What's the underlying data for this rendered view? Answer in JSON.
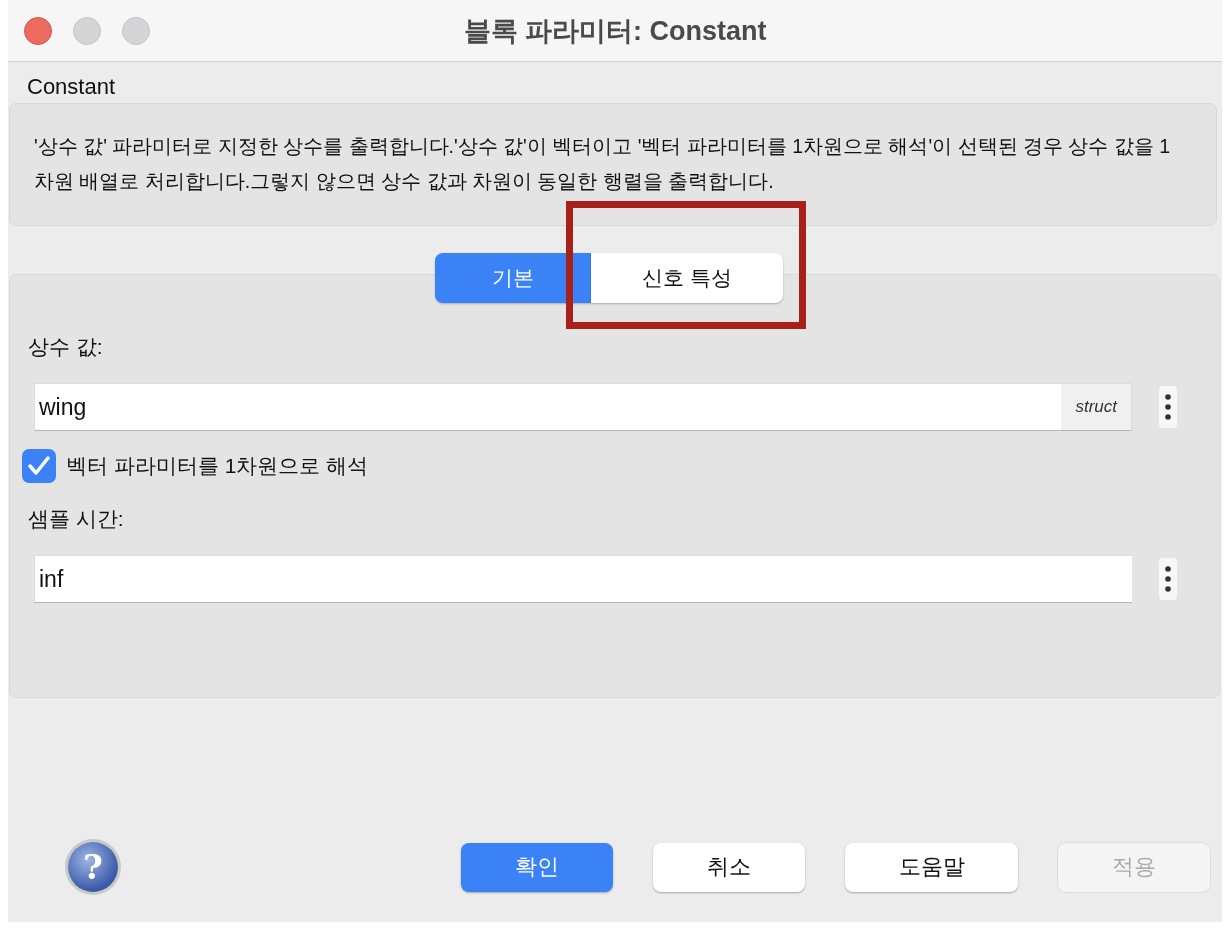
{
  "window": {
    "title": "블록 파라미터: Constant"
  },
  "block_name": "Constant",
  "description": "'상수 값' 파라미터로 지정한 상수를 출력합니다.'상수 값'이 벡터이고 '벡터 파라미터를 1차원으로 해석'이 선택된 경우 상수 값을 1차원 배열로 처리합니다.그렇지 않으면 상수 값과 차원이 동일한 행렬을 출력합니다.",
  "tabs": [
    {
      "label": "기본",
      "selected": true
    },
    {
      "label": "신호 특성",
      "selected": false
    }
  ],
  "annotation": {
    "kind": "rectangle"
  },
  "params": [
    {
      "kind": "field",
      "label": "상수 값:",
      "value": "wing",
      "tag": "struct"
    },
    {
      "kind": "checkbox",
      "label": "벡터 파라미터를 1차원으로 해석",
      "checked": true
    },
    {
      "kind": "field",
      "label": "샘플 시간:",
      "value": "inf"
    }
  ],
  "help_button": {
    "glyph": "?"
  },
  "buttons": [
    {
      "label": "확인",
      "kind": "primary",
      "disabled": false
    },
    {
      "label": "취소",
      "kind": "normal",
      "disabled": false
    },
    {
      "label": "도움말",
      "kind": "normal",
      "disabled": false
    },
    {
      "label": "적용",
      "kind": "normal",
      "disabled": true
    }
  ]
}
